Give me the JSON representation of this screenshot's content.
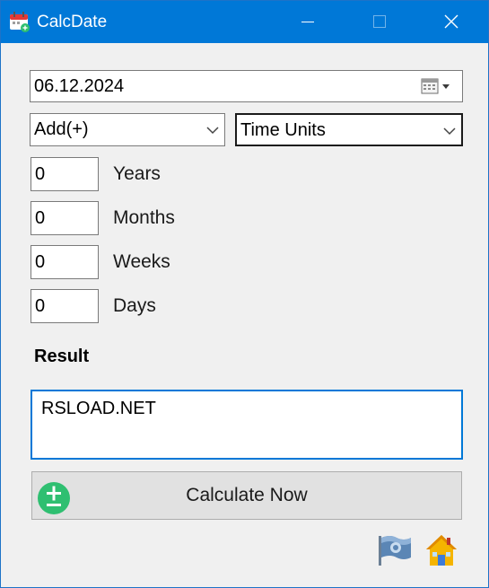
{
  "window": {
    "title": "CalcDate",
    "app_icon": "calendar-icon",
    "controls": [
      "minimize-icon",
      "maximize-icon",
      "close-icon"
    ]
  },
  "date": {
    "value": "06.12.2024",
    "picker_icon": "calendar-dropdown-icon"
  },
  "operation": {
    "selected": "Add(+)"
  },
  "unit": {
    "selected": "Time Units"
  },
  "inputs": [
    {
      "value": "0",
      "label": "Years"
    },
    {
      "value": "0",
      "label": "Months"
    },
    {
      "value": "0",
      "label": "Weeks"
    },
    {
      "value": "0",
      "label": "Days"
    }
  ],
  "result": {
    "label": "Result",
    "value": "RSLOAD.NET"
  },
  "calculate": {
    "label": "Calculate Now",
    "icon": "plus-minus-icon"
  },
  "footer_icons": [
    "flag-icon",
    "home-icon"
  ],
  "colors": {
    "titlebar": "#0078d7",
    "accent": "#0078d7",
    "calc_icon": "#2fbf71",
    "home": "#f5b400"
  }
}
